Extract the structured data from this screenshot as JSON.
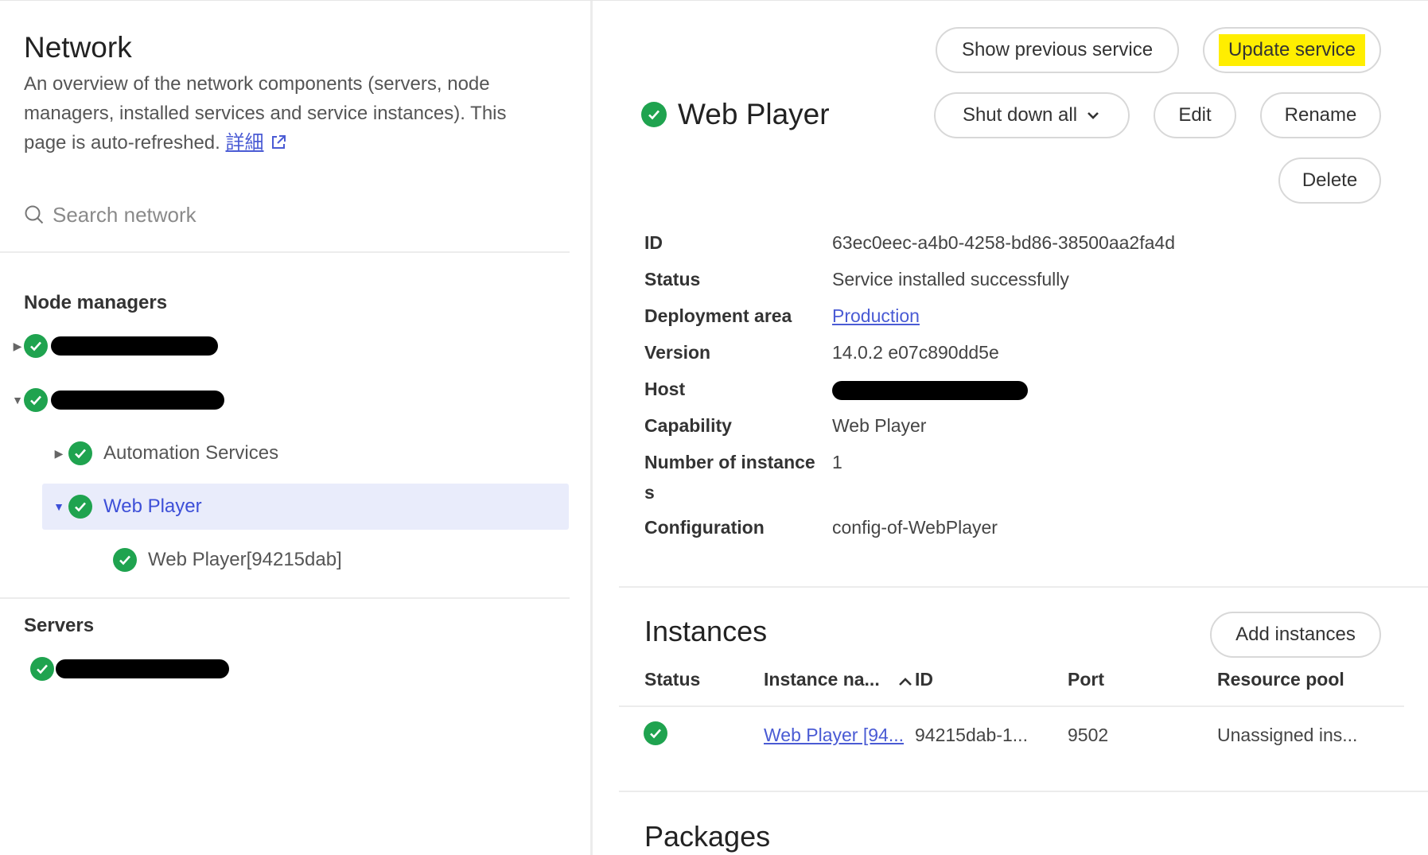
{
  "sidebar": {
    "title": "Network",
    "description": "An overview of the network components (servers, node managers, installed services and service instances). This page is auto-refreshed.",
    "details_link": "詳細",
    "search": {
      "placeholder": "Search network",
      "value": ""
    },
    "node_managers_label": "Node managers",
    "servers_label": "Servers",
    "tree": {
      "automation_services": "Automation Services",
      "web_player": "Web Player",
      "web_player_instance": "Web Player[94215dab]"
    },
    "icons": {
      "status": "check-circle-icon",
      "search": "search-icon",
      "external": "external-link-icon"
    },
    "colors": {
      "ok": "#1fa34f",
      "link": "#4a5bd4",
      "selected": "#e9ecfb"
    }
  },
  "service": {
    "title": "Web Player",
    "buttons": {
      "show_previous": "Show previous service",
      "update": "Update service",
      "shut_down_all": "Shut down all",
      "edit": "Edit",
      "rename": "Rename",
      "delete": "Delete"
    },
    "properties": [
      {
        "key": "ID",
        "value": "63ec0eec-a4b0-4258-bd86-38500aa2fa4d"
      },
      {
        "key": "Status",
        "value": "Service installed successfully"
      },
      {
        "key": "Deployment area",
        "value": "Production"
      },
      {
        "key": "Version",
        "value": "14.0.2 e07c890dd5e"
      },
      {
        "key": "Host",
        "value": ""
      },
      {
        "key": "Capability",
        "value": "Web Player"
      },
      {
        "key": "Number of instance",
        "key_wrap": "s",
        "value": "1"
      },
      {
        "key": "Configuration",
        "value": "config-of-WebPlayer"
      }
    ],
    "highlight_color": "#ffee00"
  },
  "instances": {
    "title": "Instances",
    "add_button": "Add instances",
    "columns": [
      "Status",
      "Instance na...",
      "ID",
      "Port",
      "Resource pool"
    ],
    "sort_indicator": "^",
    "rows": [
      {
        "status": "ok",
        "name": "Web Player [94...",
        "id": "94215dab-1...",
        "port": "9502",
        "resource_pool": "Unassigned ins..."
      }
    ]
  },
  "packages": {
    "title": "Packages"
  }
}
